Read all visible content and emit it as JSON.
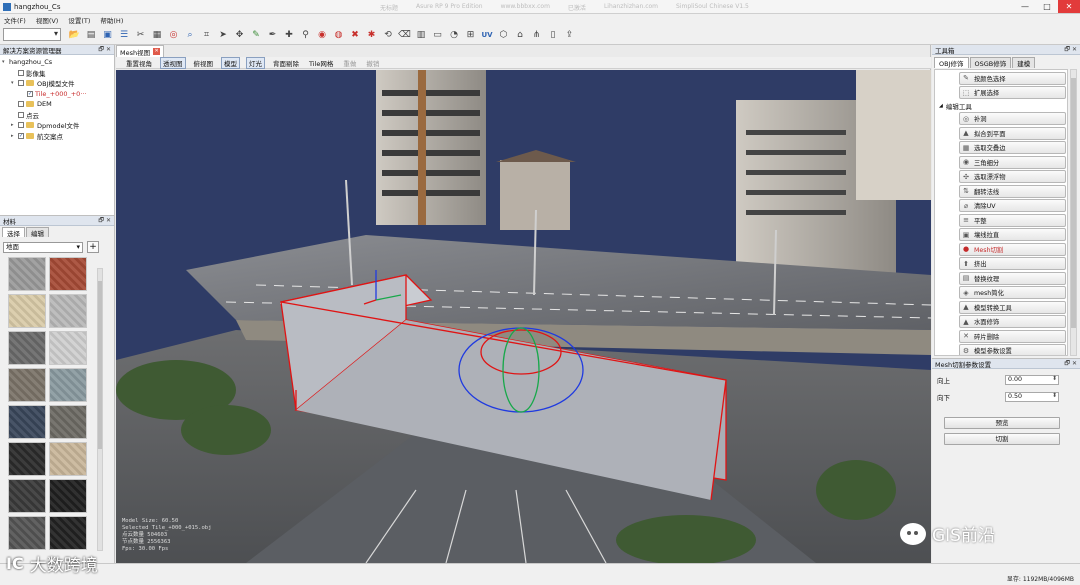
{
  "window": {
    "title": "hangzhou_Cs",
    "blurred_title_parts": [
      "无标题",
      "Asure RP 9 Pro Edition",
      "www.bbbxx.com",
      "已激活",
      "Lihanzhizhan.com",
      "SimpliSoul Chinese V1.5"
    ],
    "controls": [
      "—",
      "□",
      "✕"
    ]
  },
  "menu": [
    "文件(F)",
    "视图(V)",
    "设置(T)",
    "帮助(H)"
  ],
  "toolbar": {
    "icons": [
      "folder-icon",
      "save-icon",
      "cube-icon",
      "layers-icon",
      "cut-icon",
      "grid-icon",
      "target-icon",
      "search-icon",
      "crop-icon",
      "cursor-icon",
      "move-icon",
      "brush-icon",
      "pen-icon",
      "plus-icon",
      "pin-icon",
      "circle-icon",
      "ring-icon",
      "cross-icon",
      "star-icon",
      "sync-icon",
      "eraser-icon",
      "box-icon",
      "film-icon",
      "pie-icon",
      "label-icon",
      "uv-icon",
      "mesh-icon",
      "home-icon",
      "tree-icon",
      "doc-icon",
      "export-icon"
    ],
    "uv_label": "UV"
  },
  "left_tree": {
    "header": "解决方案资源管理器",
    "items": [
      {
        "label": "hangzhou_Cs",
        "level": 0,
        "exp": "▾",
        "cb": "",
        "folder": false,
        "red": false
      },
      {
        "label": "影像集",
        "level": 1,
        "exp": "",
        "cb": "",
        "folder": false,
        "red": false
      },
      {
        "label": "OBJ模型文件",
        "level": 1,
        "exp": "▾",
        "cb": "",
        "folder": true,
        "red": false
      },
      {
        "label": "Tile_+000_+0···",
        "level": 2,
        "exp": "",
        "cb": "✓",
        "folder": false,
        "red": true
      },
      {
        "label": "DEM",
        "level": 1,
        "exp": "",
        "cb": "",
        "folder": true,
        "red": false
      },
      {
        "label": "点云",
        "level": 1,
        "exp": "",
        "cb": "",
        "folder": false,
        "red": false
      },
      {
        "label": "Dpmodel文件",
        "level": 1,
        "exp": "▸",
        "cb": "",
        "folder": true,
        "red": false
      },
      {
        "label": "航交案点",
        "level": 1,
        "exp": "▸",
        "cb": "✓",
        "folder": true,
        "red": false
      }
    ]
  },
  "materials": {
    "header": "材料",
    "tabs": [
      "选择",
      "编辑"
    ],
    "selected": "地面",
    "add_label": "+",
    "thumb_colors": [
      "#9a9a9a",
      "#a64b36",
      "#d9cba8",
      "#b9b9b9",
      "#6a6a6a",
      "#cfcfcf",
      "#7b7368",
      "#8a9aa0",
      "#39465a",
      "#6d6a64",
      "#2b2b2b",
      "#c9b69a",
      "#3a3a3a",
      "#1f1f1f",
      "#555",
      "#222"
    ]
  },
  "viewport": {
    "tab_label": "Mesh视图",
    "view_buttons": [
      {
        "label": "重置视角",
        "state": ""
      },
      {
        "label": "透视图",
        "state": "on"
      },
      {
        "label": "俯视图",
        "state": ""
      },
      {
        "label": "模型",
        "state": "on"
      },
      {
        "label": "灯光",
        "state": "on"
      },
      {
        "label": "背面剔除",
        "state": ""
      },
      {
        "label": "Tile网格",
        "state": ""
      },
      {
        "label": "重做",
        "state": "dis"
      },
      {
        "label": "撤销",
        "state": "dis"
      }
    ],
    "overlay_lines": [
      "Model Size: 60.50",
      "Selected Tile_+000_+015.obj",
      "点云数量 504603",
      "节点数量 2556363",
      "Fps: 30.00 Fps"
    ],
    "colors": {
      "sky": "#2f3c66",
      "selection_box": "#e01414",
      "box_fill": "#a9adb4"
    }
  },
  "toolbox": {
    "header": "工具箱",
    "tabs": [
      "OBJ修饰",
      "OSGB修饰",
      "建模"
    ],
    "top_items": [
      {
        "label": "按颜色选择",
        "icon": "✎",
        "red": false
      },
      {
        "label": "扩展选择",
        "icon": "⬚",
        "red": false
      }
    ],
    "group_label": "编辑工具",
    "items": [
      {
        "label": "补洞",
        "icon": "◎",
        "red": false
      },
      {
        "label": "拟合到平面",
        "icon": "▲",
        "red": false
      },
      {
        "label": "选取交叠边",
        "icon": "▦",
        "red": false
      },
      {
        "label": "三角细分",
        "icon": "◉",
        "red": false
      },
      {
        "label": "选取漂浮物",
        "icon": "✣",
        "red": false
      },
      {
        "label": "翻转法线",
        "icon": "⇅",
        "red": false
      },
      {
        "label": "清除UV",
        "icon": "⌀",
        "red": false
      },
      {
        "label": "平整",
        "icon": "≡",
        "red": false
      },
      {
        "label": "壤线拉直",
        "icon": "▣",
        "red": false
      },
      {
        "label": "Mesh切割",
        "icon": "●",
        "red": true
      },
      {
        "label": "挤出",
        "icon": "⬆",
        "red": false
      },
      {
        "label": "替换纹理",
        "icon": "▤",
        "red": false
      },
      {
        "label": "mesh简化",
        "icon": "◈",
        "red": false
      },
      {
        "label": "模型转换工具",
        "icon": "▲",
        "red": false
      },
      {
        "label": "水面修饰",
        "icon": "▲",
        "red": false
      },
      {
        "label": "碎片删除",
        "icon": "✕",
        "red": false
      },
      {
        "label": "模型参数设置",
        "icon": "⚙",
        "red": false
      }
    ]
  },
  "params": {
    "header": "Mesh切割参数设置",
    "fields": [
      {
        "label": "向上",
        "value": "0.00"
      },
      {
        "label": "向下",
        "value": "0.50"
      }
    ],
    "buttons": [
      "预览",
      "切割"
    ]
  },
  "status": {
    "memory": "显存: 1192MB/4096MB"
  },
  "watermarks": {
    "left_logo": "IC",
    "left_text": "大数跨境",
    "right_text": "GIS前沿"
  }
}
